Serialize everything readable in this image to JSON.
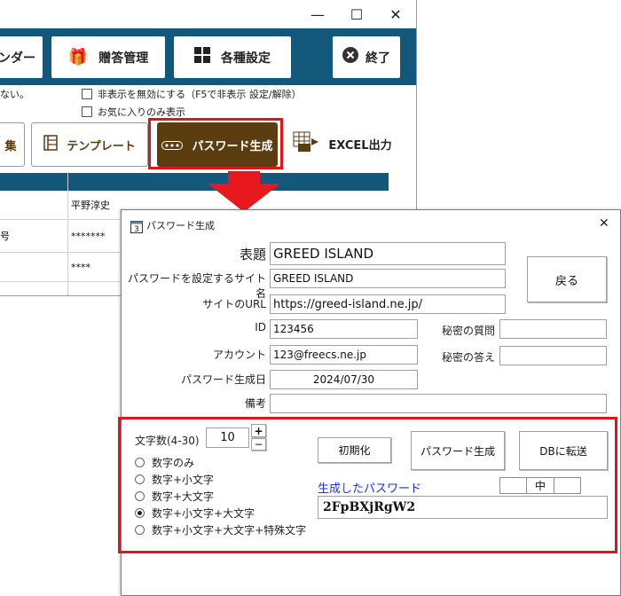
{
  "background_window": {
    "controls": {
      "minimize": "—",
      "maximize": "☐",
      "close": "✕"
    },
    "toolbar": {
      "calendar_partial": "ンダー",
      "gift_label": "贈答管理",
      "settings_label": "各種設定",
      "exit_label": "終了"
    },
    "options": {
      "partial_text": "ない。",
      "disable_hide": "非表示を無効にする（F5で非表示 設定/解除）",
      "favorites_only": "お気に入りのみ表示"
    },
    "nav": {
      "edit_partial": "集",
      "template": "テンプレート",
      "password_gen": "パスワード生成",
      "excel": "EXCEL出力",
      "excel_badge": "xls"
    },
    "grid": {
      "rows": [
        {
          "c1": "",
          "c2": "平野淳史"
        },
        {
          "c1": "号",
          "c2": "*******"
        },
        {
          "c1": "",
          "c2": "****"
        }
      ]
    }
  },
  "dialog": {
    "title": "パスワード生成",
    "close": "✕",
    "labels": {
      "subject": "表題",
      "site_name": "パスワードを設定するサイト名",
      "url": "サイトのURL",
      "id": "ID",
      "account": "アカウント",
      "created": "パスワード生成日",
      "notes": "備考",
      "secret_q": "秘密の質問",
      "secret_a": "秘密の答え"
    },
    "values": {
      "subject": "GREED ISLAND",
      "site_name": "GREED ISLAND",
      "url": "https://greed-island.ne.jp/",
      "id": "123456",
      "account": "123@freecs.ne.jp",
      "created": "2024/07/30",
      "notes": "",
      "secret_q": "",
      "secret_a": ""
    },
    "back_button": "戻る",
    "generator": {
      "length_label": "文字数(4-30)",
      "length_value": "10",
      "plus": "+",
      "minus": "−",
      "reset_button": "初期化",
      "generate_button": "パスワード生成",
      "transfer_button": "DBに転送",
      "options": [
        {
          "label": "数字のみ",
          "selected": false
        },
        {
          "label": "数字+小文字",
          "selected": false
        },
        {
          "label": "数字+大文字",
          "selected": false
        },
        {
          "label": "数字+小文字+大文字",
          "selected": true
        },
        {
          "label": "数字+小文字+大文字+特殊文字",
          "selected": false
        }
      ],
      "generated_label": "生成したパスワード",
      "strength": "中",
      "generated_password": "2FpBXjRgW2",
      "generated_label_color": "#1a35d6"
    }
  },
  "colors": {
    "toolbar": "#13587a",
    "highlight": "#e3131a",
    "pw_button_bg": "#5b3d0f",
    "arrow": "#e8191e"
  }
}
